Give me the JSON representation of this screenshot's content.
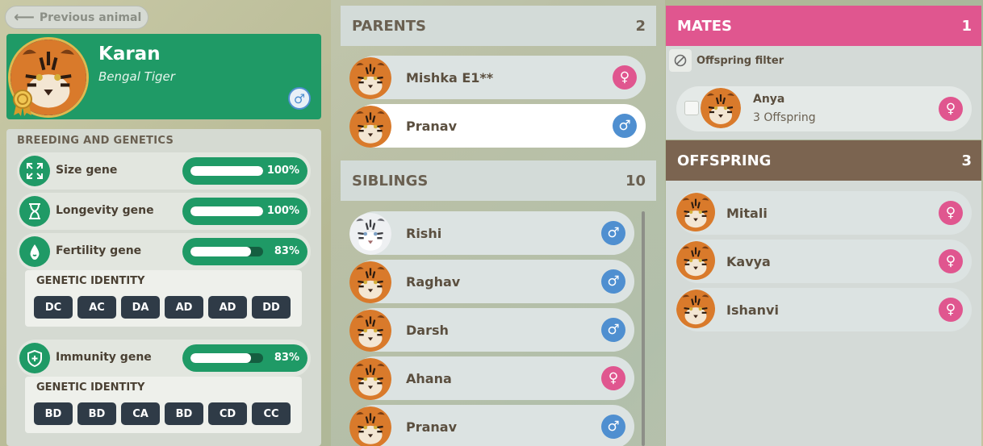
{
  "nav": {
    "previous_label": "Previous animal"
  },
  "animal": {
    "name": "Karan",
    "species": "Bengal Tiger",
    "sex_symbol": "♂"
  },
  "genetics": {
    "title": "BREEDING AND GENETICS",
    "genes": [
      {
        "label": "Size gene",
        "value": "100%",
        "fraction": 1.0,
        "icon": "expand-icon"
      },
      {
        "label": "Longevity gene",
        "value": "100%",
        "fraction": 1.0,
        "icon": "hourglass-icon"
      },
      {
        "label": "Fertility gene",
        "value": "83%",
        "fraction": 0.83,
        "icon": "fertility-icon"
      },
      {
        "label": "Immunity gene",
        "value": "83%",
        "fraction": 0.83,
        "icon": "shield-icon"
      }
    ],
    "fertility_identity": {
      "title": "GENETIC IDENTITY",
      "codes": [
        "DC",
        "AC",
        "DA",
        "AD",
        "AD",
        "DD"
      ]
    },
    "immunity_identity": {
      "title": "GENETIC IDENTITY",
      "codes": [
        "BD",
        "BD",
        "CA",
        "BD",
        "CD",
        "CC"
      ]
    }
  },
  "parents": {
    "title": "PARENTS",
    "count": "2",
    "items": [
      {
        "name": "Mishka E1**",
        "sex": "♀",
        "sex_type": "female"
      },
      {
        "name": "Pranav",
        "sex": "♂",
        "sex_type": "male",
        "selected": true
      }
    ]
  },
  "siblings": {
    "title": "SIBLINGS",
    "count": "10",
    "items": [
      {
        "name": "Rishi",
        "sex": "♂",
        "sex_type": "male",
        "white": true
      },
      {
        "name": "Raghav",
        "sex": "♂",
        "sex_type": "male"
      },
      {
        "name": "Darsh",
        "sex": "♂",
        "sex_type": "male"
      },
      {
        "name": "Ahana",
        "sex": "♀",
        "sex_type": "female"
      },
      {
        "name": "Pranav",
        "sex": "♂",
        "sex_type": "male"
      }
    ]
  },
  "mates": {
    "title": "MATES",
    "count": "1",
    "filter_label": "Offspring filter",
    "items": [
      {
        "name": "Anya",
        "offspring": "3 Offspring",
        "sex": "♀"
      }
    ]
  },
  "offspring": {
    "title": "OFFSPRING",
    "count": "3",
    "items": [
      {
        "name": "Mitali",
        "sex": "♀"
      },
      {
        "name": "Kavya",
        "sex": "♀"
      },
      {
        "name": "Ishanvi",
        "sex": "♀"
      }
    ]
  },
  "colors": {
    "green": "#1f9a66",
    "pink": "#e0568f",
    "blue": "#4f8fd0",
    "brown": "#7b6450"
  }
}
